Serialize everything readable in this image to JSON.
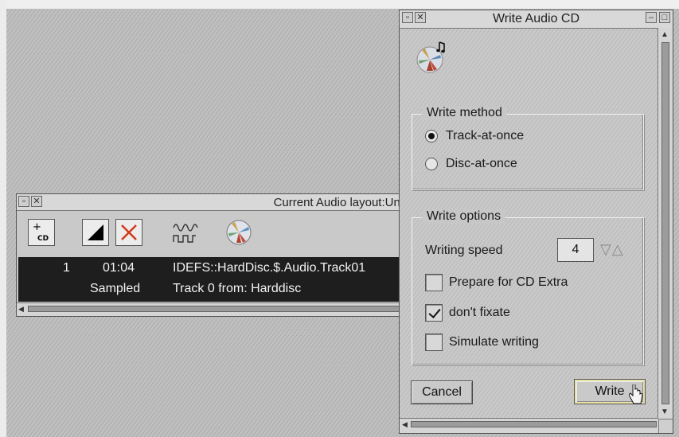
{
  "layout_window": {
    "title": "Current Audio layout:Unt",
    "toolbar": [
      "add-cd-tool",
      "contrast-tool",
      "delete-tool",
      "waveform-tool",
      "cd-app-tool"
    ],
    "add_cd_label": "CD",
    "track": {
      "number": "1",
      "time": "01:04",
      "path": "IDEFS::HardDisc.$.Audio.Track01",
      "type": "Sampled",
      "source": "Track 0 from: Harddisc"
    }
  },
  "dialog": {
    "title": "Write Audio CD",
    "write_method": {
      "label": "Write method",
      "options": [
        {
          "label": "Track-at-once",
          "selected": true
        },
        {
          "label": "Disc-at-once",
          "selected": false
        }
      ]
    },
    "write_options": {
      "label": "Write options",
      "speed_label": "Writing speed",
      "speed_value": "4",
      "checks": [
        {
          "label": "Prepare for CD Extra",
          "checked": false
        },
        {
          "label": "don't fixate",
          "checked": true
        },
        {
          "label": "Simulate writing",
          "checked": false
        }
      ]
    },
    "buttons": {
      "cancel": "Cancel",
      "write": "Write"
    }
  },
  "colors": {
    "desktop": "#bdbdbd",
    "window": "#c7c7c7",
    "track_bg": "#1e1e1e",
    "default_button_ring": "#e9e2a9"
  }
}
